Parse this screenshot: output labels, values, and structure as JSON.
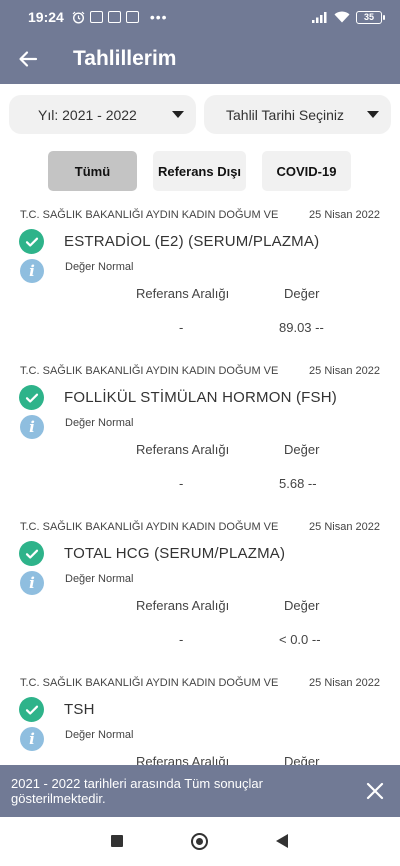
{
  "status_bar": {
    "time": "19:24",
    "battery": "35",
    "icons": [
      "alarm-icon",
      "app-notification-icon",
      "box-icon",
      "news-icon",
      "signal-icon",
      "wifi-icon"
    ]
  },
  "app_bar": {
    "title": "Tahlillerim",
    "back_icon": "arrow-left-icon"
  },
  "filters": {
    "year": "Yıl: 2021 - 2022",
    "date": "Tahlil Tarihi Seçiniz"
  },
  "chips": [
    {
      "label": "Tümü",
      "active": true
    },
    {
      "label": "Referans Dışı",
      "active": false
    },
    {
      "label": "COVID-19",
      "active": false
    }
  ],
  "results": [
    {
      "hospital": "T.C. SAĞLIK BAKANLIĞI AYDIN KADIN DOĞUM VE",
      "date": "25 Nisan 2022",
      "name": "ESTRADİOL (E2) (SERUM/PLAZMA)",
      "status": "Değer Normal",
      "ref_label": "Referans Aralığı",
      "value_label": "Değer",
      "ref_value": "-",
      "value": "89.03 --"
    },
    {
      "hospital": "T.C. SAĞLIK BAKANLIĞI AYDIN KADIN DOĞUM VE",
      "date": "25 Nisan 2022",
      "name": "FOLLİKÜL STİMÜLAN HORMON (FSH)",
      "status": "Değer Normal",
      "ref_label": "Referans Aralığı",
      "value_label": "Değer",
      "ref_value": "-",
      "value": "5.68 --"
    },
    {
      "hospital": "T.C. SAĞLIK BAKANLIĞI AYDIN KADIN DOĞUM VE",
      "date": "25 Nisan 2022",
      "name": "TOTAL HCG (SERUM/PLAZMA)",
      "status": "Değer Normal",
      "ref_label": "Referans Aralığı",
      "value_label": "Değer",
      "ref_value": "-",
      "value": "< 0.0 --"
    },
    {
      "hospital": "T.C. SAĞLIK BAKANLIĞI AYDIN KADIN DOĞUM VE",
      "date": "25 Nisan 2022",
      "name": "TSH",
      "status": "Değer Normal",
      "ref_label": "Referans Aralığı",
      "value_label": "Değer"
    }
  ],
  "snackbar": {
    "message": "2021 - 2022 tarihleri arasında Tüm sonuçlar gösterilmektedir."
  },
  "colors": {
    "primary": "#717a95",
    "check": "#2eb38a",
    "info": "#8fbedf",
    "chip_active": "#c4c4c4",
    "chip_bg": "#f1f1f1"
  }
}
